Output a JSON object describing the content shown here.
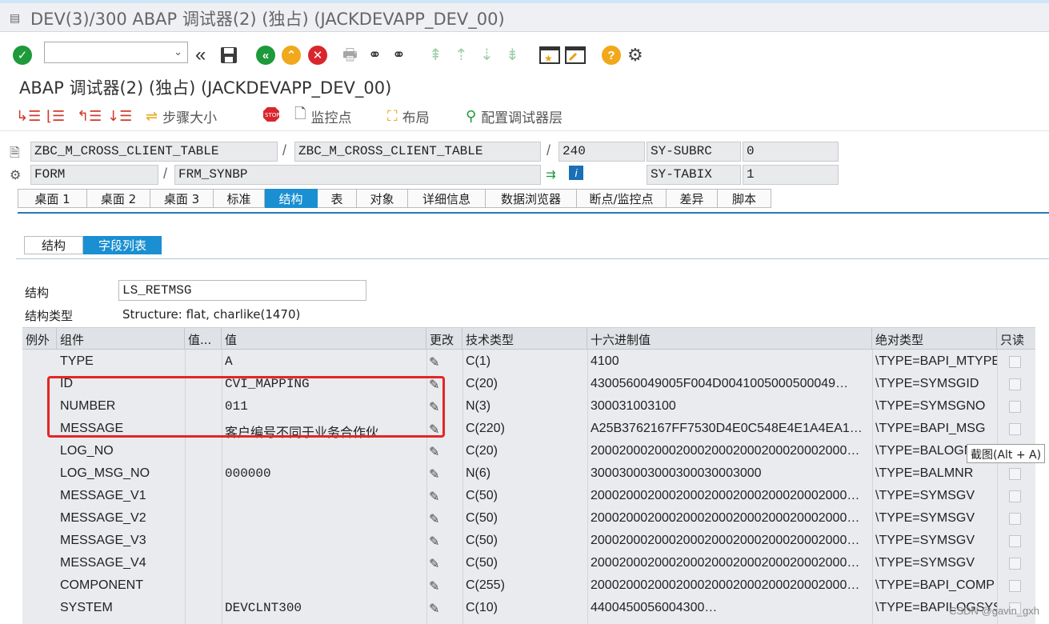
{
  "window": {
    "title": "DEV(3)/300 ABAP 调试器(2)  (独占) (JACKDEVAPP_DEV_00)"
  },
  "debugger": {
    "title": "ABAP 调试器(2)  (独占) (JACKDEVAPP_DEV_00)"
  },
  "toolbar2": {
    "step_size": "步骤大小",
    "watchpoint": "监控点",
    "layout": "布局",
    "config_layer": "配置调试器层"
  },
  "info": {
    "program": "ZBC_M_CROSS_CLIENT_TABLE",
    "include": "ZBC_M_CROSS_CLIENT_TABLE",
    "line": "240",
    "type": "FORM",
    "event": "FRM_SYNBP",
    "sy1_label": "SY-SUBRC",
    "sy1_value": "0",
    "sy2_label": "SY-TABIX",
    "sy2_value": "1",
    "slash": "/"
  },
  "tabs": [
    "桌面 1",
    "桌面 2",
    "桌面 3",
    "标准",
    "结构",
    "表",
    "对象",
    "详细信息",
    "数据浏览器",
    "断点/监控点",
    "差异",
    "脚本"
  ],
  "subtabs": [
    "结构",
    "字段列表"
  ],
  "structure": {
    "label": "结构",
    "value": "LS_RETMSG",
    "type_label": "结构类型",
    "type_value": "Structure: flat, charlike(1470)"
  },
  "table": {
    "headers": [
      "例外",
      "组件",
      "值...",
      "值",
      "更改",
      "技术类型",
      "十六进制值",
      "绝对类型",
      "只读"
    ],
    "rows": [
      {
        "comp": "TYPE",
        "val": "A",
        "tech": "C(1)",
        "hex": "4100",
        "abs": "\\TYPE=BAPI_MTYPE"
      },
      {
        "comp": "ID",
        "val": "CVI_MAPPING",
        "tech": "C(20)",
        "hex": "4300560049005F004D0041005000500049…",
        "abs": "\\TYPE=SYMSGID"
      },
      {
        "comp": "NUMBER",
        "val": "011",
        "tech": "N(3)",
        "hex": "300031003100",
        "abs": "\\TYPE=SYMSGNO"
      },
      {
        "comp": "MESSAGE",
        "val": "客户编号不同于业务合作伙…",
        "tech": "C(220)",
        "hex": "A25B3762167FF7530D4E0C548E4E1A4EA1…",
        "abs": "\\TYPE=BAPI_MSG"
      },
      {
        "comp": "LOG_NO",
        "val": "",
        "tech": "C(20)",
        "hex": "200020002000200020002000200020002000…",
        "abs": "\\TYPE=BALOGNR"
      },
      {
        "comp": "LOG_MSG_NO",
        "val": "000000",
        "tech": "N(6)",
        "hex": "300030003000300030003000",
        "abs": "\\TYPE=BALMNR"
      },
      {
        "comp": "MESSAGE_V1",
        "val": "",
        "tech": "C(50)",
        "hex": "200020002000200020002000200020002000…",
        "abs": "\\TYPE=SYMSGV"
      },
      {
        "comp": "MESSAGE_V2",
        "val": "",
        "tech": "C(50)",
        "hex": "200020002000200020002000200020002000…",
        "abs": "\\TYPE=SYMSGV"
      },
      {
        "comp": "MESSAGE_V3",
        "val": "",
        "tech": "C(50)",
        "hex": "200020002000200020002000200020002000…",
        "abs": "\\TYPE=SYMSGV"
      },
      {
        "comp": "MESSAGE_V4",
        "val": "",
        "tech": "C(50)",
        "hex": "200020002000200020002000200020002000…",
        "abs": "\\TYPE=SYMSGV"
      },
      {
        "comp": "COMPONENT",
        "val": "",
        "tech": "C(255)",
        "hex": "200020002000200020002000200020002000…",
        "abs": "\\TYPE=BAPI_COMP"
      },
      {
        "comp": "SYSTEM",
        "val": "DEVCLNT300",
        "tech": "C(10)",
        "hex": "4400450056004300…",
        "abs": "\\TYPE=BAPILOGSYS"
      }
    ]
  },
  "tooltip": "截图(Alt + A)",
  "watermark": "CSDN @gavin_gxh",
  "colors": {
    "accent": "#1a8fd2",
    "highlight_box": "#e32626"
  }
}
